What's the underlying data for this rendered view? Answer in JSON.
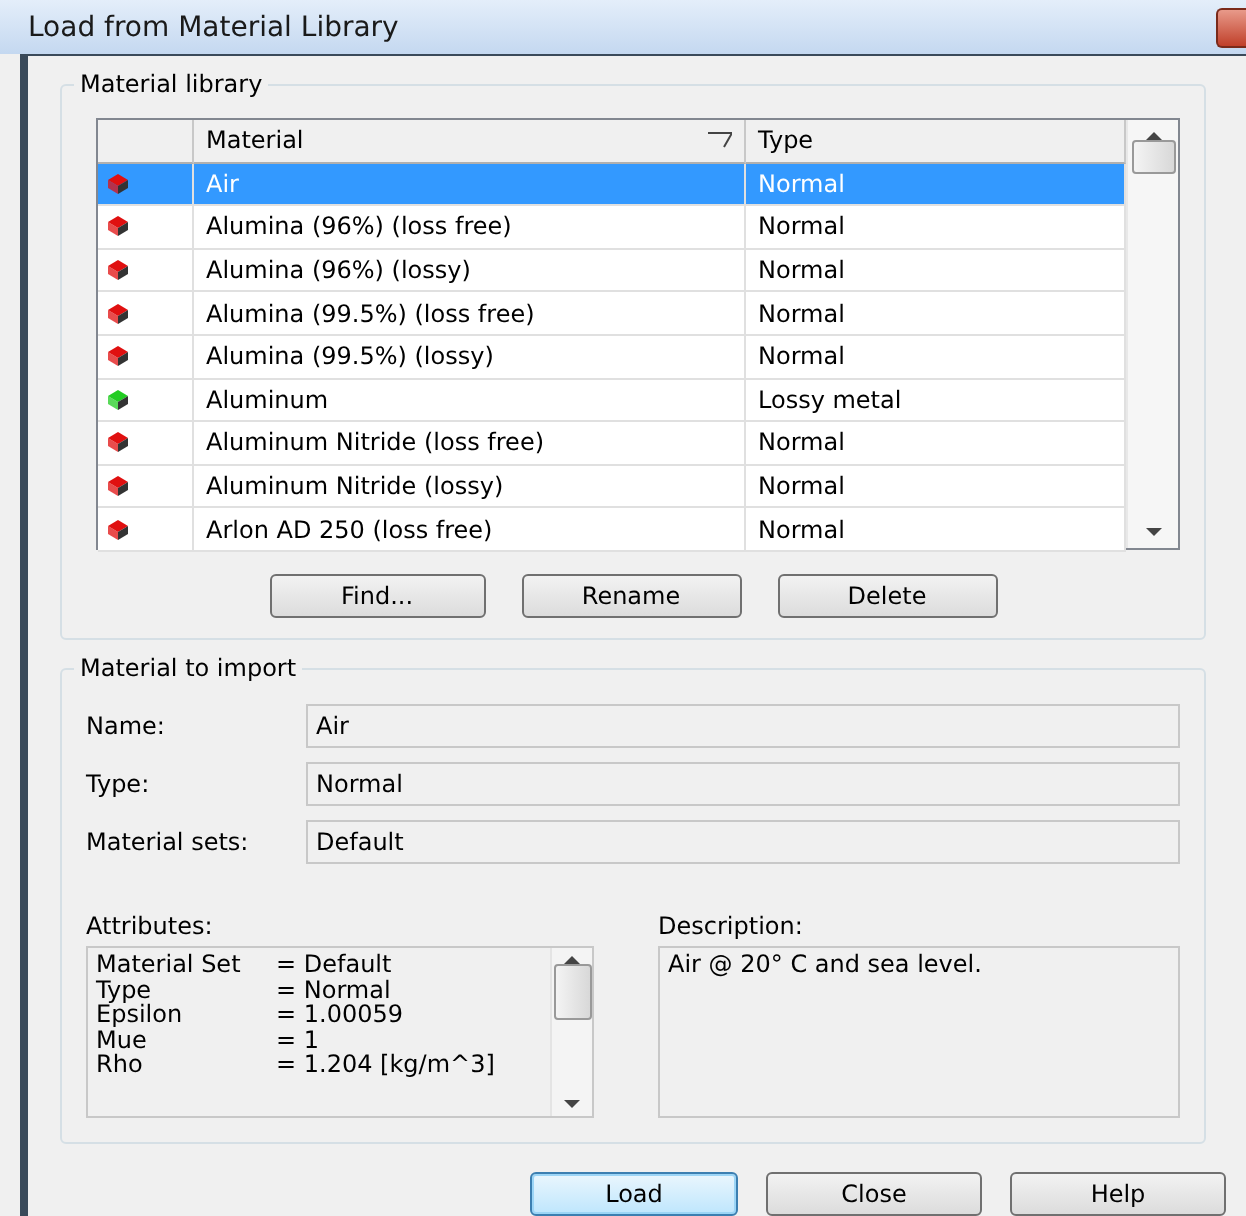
{
  "window": {
    "title": "Load from Material Library"
  },
  "library": {
    "title": "Material library",
    "columns": [
      "Material",
      "Type"
    ],
    "rows": [
      {
        "material": "Air",
        "type": "Normal",
        "color": "#e01010",
        "selected": true
      },
      {
        "material": "Alumina (96%) (loss free)",
        "type": "Normal",
        "color": "#e01010",
        "selected": false
      },
      {
        "material": "Alumina (96%) (lossy)",
        "type": "Normal",
        "color": "#e01010",
        "selected": false
      },
      {
        "material": "Alumina (99.5%) (loss free)",
        "type": "Normal",
        "color": "#e01010",
        "selected": false
      },
      {
        "material": "Alumina (99.5%) (lossy)",
        "type": "Normal",
        "color": "#e01010",
        "selected": false
      },
      {
        "material": "Aluminum",
        "type": "Lossy metal",
        "color": "#22cc22",
        "selected": false
      },
      {
        "material": "Aluminum Nitride (loss free)",
        "type": "Normal",
        "color": "#e01010",
        "selected": false
      },
      {
        "material": "Aluminum Nitride (lossy)",
        "type": "Normal",
        "color": "#e01010",
        "selected": false
      },
      {
        "material": "Arlon AD 250 (loss free)",
        "type": "Normal",
        "color": "#e01010",
        "selected": false
      }
    ],
    "buttons": [
      "Find...",
      "Rename",
      "Delete"
    ]
  },
  "import": {
    "title": "Material to import",
    "fields": [
      {
        "label": "Name:",
        "value": "Air"
      },
      {
        "label": "Type:",
        "value": "Normal"
      },
      {
        "label": "Material sets:",
        "value": "Default"
      }
    ],
    "attributes_label": "Attributes:",
    "attributes": [
      {
        "name": "Material Set",
        "value": "= Default"
      },
      {
        "name": "Type",
        "value": "= Normal"
      },
      {
        "name": "Epsilon",
        "value": "= 1.00059"
      },
      {
        "name": "Mue",
        "value": "= 1"
      },
      {
        "name": "Rho",
        "value": "= 1.204 [kg/m^3]"
      }
    ],
    "description_label": "Description:",
    "description": "Air @ 20° C and sea level."
  },
  "buttons": [
    {
      "label": "Load",
      "selected": true
    },
    {
      "label": "Close",
      "selected": false
    },
    {
      "label": "Help",
      "selected": false
    }
  ]
}
